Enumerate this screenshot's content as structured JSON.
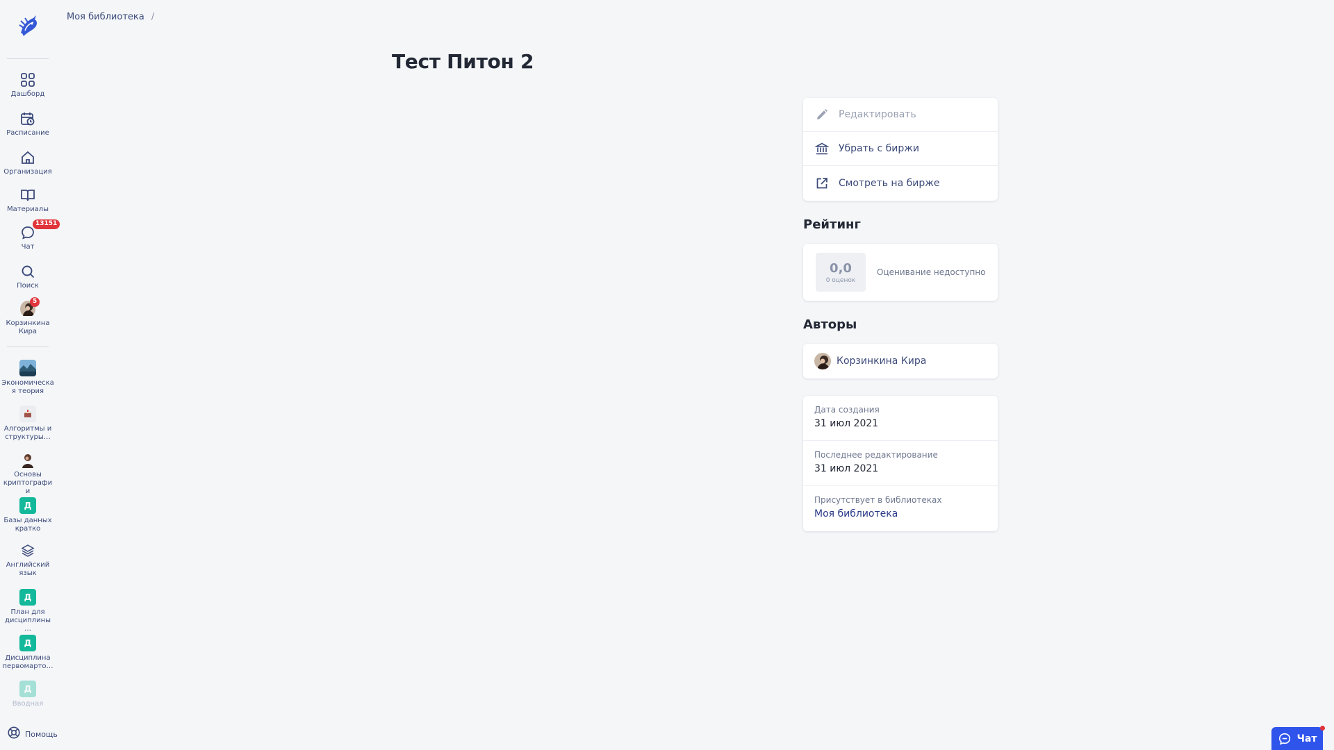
{
  "breadcrumb": {
    "items": [
      "Моя библиотека"
    ],
    "separator": "/"
  },
  "page": {
    "title": "Тест Питон 2"
  },
  "sidebar": {
    "nav": [
      {
        "label": "Дашборд",
        "icon": "grid-icon"
      },
      {
        "label": "Расписание",
        "icon": "calendar-icon"
      },
      {
        "label": "Организация",
        "icon": "home-icon"
      },
      {
        "label": "Материалы",
        "icon": "book-icon"
      },
      {
        "label": "Чат",
        "icon": "chat-icon",
        "badge": "13151"
      },
      {
        "label": "Поиск",
        "icon": "search-icon"
      },
      {
        "label": "Корзинкина Кира",
        "icon": "avatar",
        "badge": "5"
      }
    ],
    "courses": [
      {
        "label": "Экономическая теория",
        "icon": "landscape-thumb"
      },
      {
        "label": "Алгоритмы и структуры…",
        "icon": "cake-thumb"
      },
      {
        "label": "Основы криптографии",
        "icon": "person-thumb"
      },
      {
        "label": "Базы данных кратко",
        "icon": "d-tile",
        "letter": "Д"
      },
      {
        "label": "Английский язык",
        "icon": "layers-icon"
      },
      {
        "label": "План для дисциплины…",
        "icon": "d-tile",
        "letter": "Д"
      },
      {
        "label": "Дисциплина первомарто…",
        "icon": "d-tile",
        "letter": "Д"
      },
      {
        "label": "Вводная",
        "icon": "d-tile",
        "letter": "Д"
      }
    ],
    "help_label": "Помощь"
  },
  "actions": [
    {
      "label": "Редактировать",
      "icon": "pencil-icon",
      "disabled": true
    },
    {
      "label": "Убрать с биржи",
      "icon": "bank-icon",
      "disabled": false
    },
    {
      "label": "Смотреть на бирже",
      "icon": "external-link-icon",
      "disabled": false
    }
  ],
  "rating": {
    "title": "Рейтинг",
    "value": "0,0",
    "count": "0 оценок",
    "note": "Оценивание недоступно"
  },
  "authors": {
    "title": "Авторы",
    "list": [
      {
        "name": "Корзинкина Кира"
      }
    ]
  },
  "meta": {
    "created_label": "Дата создания",
    "created_value": "31 июл 2021",
    "edited_label": "Последнее редактирование",
    "edited_value": "31 июл 2021",
    "libraries_label": "Присутствует в библиотеках",
    "libraries_value": "Моя библиотека"
  },
  "chat_widget": {
    "label": "Чат"
  },
  "colors": {
    "accent": "#2f54eb",
    "nav_text": "#3c4a7a",
    "badge": "#e0353b",
    "tile": "#14b89a"
  }
}
